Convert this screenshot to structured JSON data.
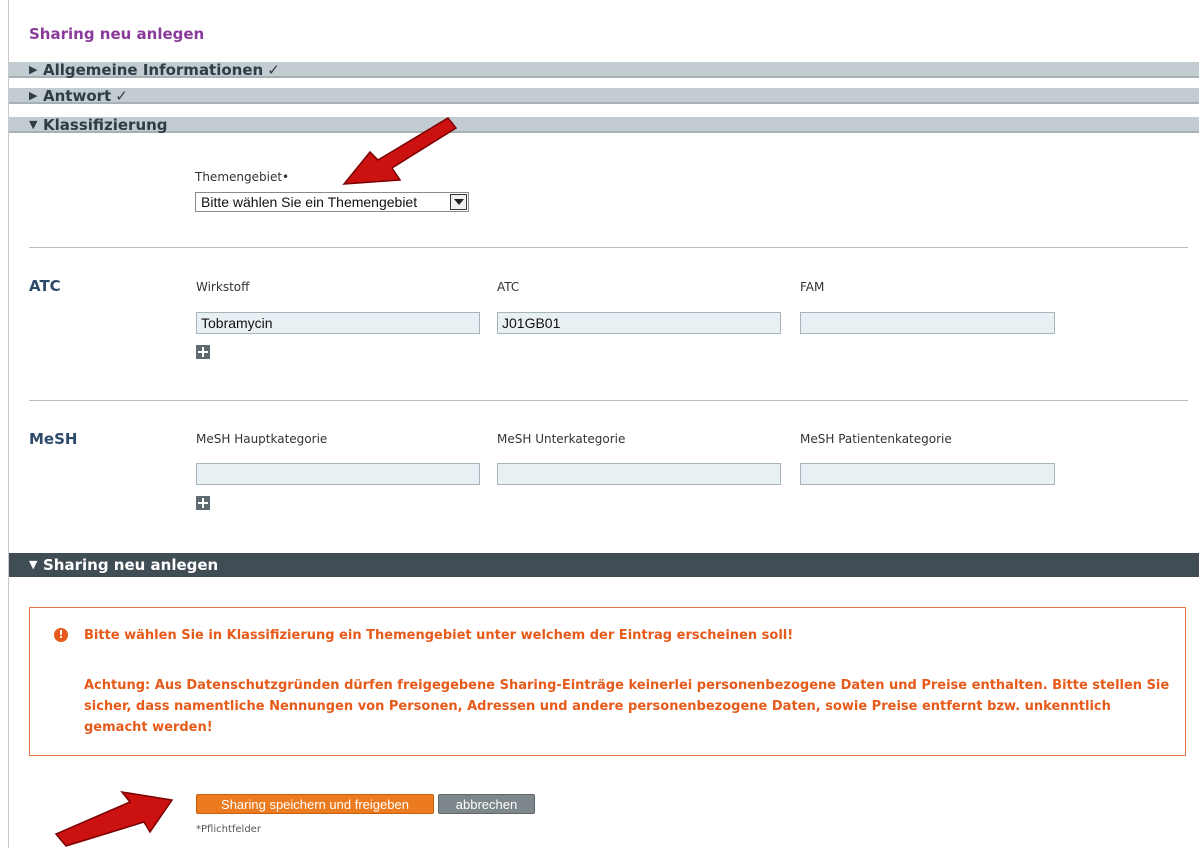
{
  "page": {
    "title": "Sharing neu anlegen"
  },
  "sections": {
    "allgemein": {
      "label": "Allgemeine Informationen",
      "check": "✓",
      "arrow": "▶"
    },
    "antwort": {
      "label": "Antwort",
      "check": "✓",
      "arrow": "▶"
    },
    "klassifizierung": {
      "label": "Klassifizierung",
      "arrow": "▼"
    },
    "sharing": {
      "label": "Sharing neu anlegen",
      "arrow": "▼"
    }
  },
  "themengebiet": {
    "label": "Themengebiet•",
    "selected": "Bitte wählen Sie ein Themengebiet"
  },
  "atc": {
    "title": "ATC",
    "columns": [
      "Wirkstoff",
      "ATC",
      "FAM"
    ],
    "values": [
      "Tobramycin",
      "J01GB01",
      ""
    ]
  },
  "mesh": {
    "title": "MeSH",
    "columns": [
      "MeSH Hauptkategorie",
      "MeSH Unterkategorie",
      "MeSH Patientenkategorie"
    ],
    "values": [
      "",
      "",
      ""
    ]
  },
  "alert": {
    "icon": "!",
    "message": "Bitte wählen Sie in Klassifizierung ein Themengebiet unter welchem der Eintrag erscheinen soll!",
    "warning": "Achtung: Aus Datenschutzgründen dürfen freigegebene Sharing-Einträge keinerlei personenbezogene Daten und Preise enthalten. Bitte stellen Sie sicher, dass namentliche Nennungen von Personen, Adressen und andere personenbezogene Daten, sowie Preise entfernt bzw. unkenntlich gemacht werden!"
  },
  "buttons": {
    "save": "Sharing speichern und freigeben",
    "cancel": "abbrechen"
  },
  "footnote": "*Pflichtfelder",
  "colors": {
    "title": "#8a3a9a",
    "section_bar": "#c2ccd1",
    "dark_bar": "#404d55",
    "alert": "#e65a1a",
    "primary_button": "#ec7a1e",
    "annotation_arrow": "#cc1111"
  }
}
